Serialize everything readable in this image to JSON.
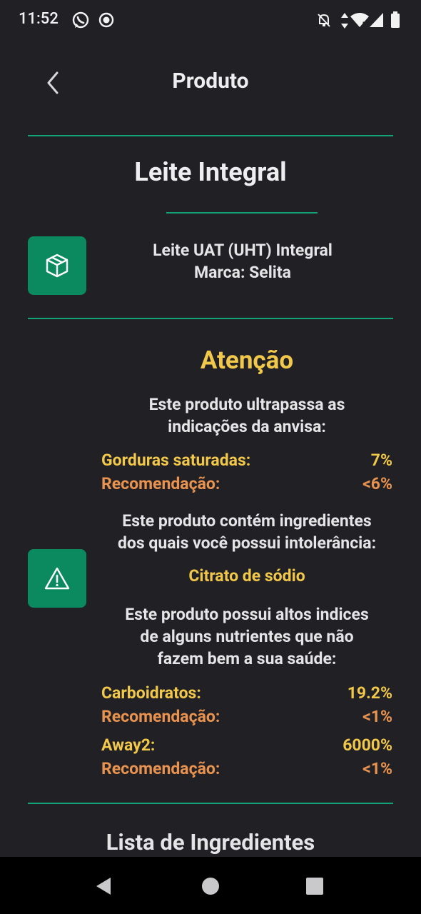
{
  "status_bar": {
    "time": "11:52",
    "icons": [
      "whatsapp-icon",
      "record-icon",
      "notifications-off-icon",
      "data-arrows-icon",
      "wifi-icon",
      "cellular-signal-icon",
      "battery-icon"
    ]
  },
  "header": {
    "title": "Produto",
    "back_icon": "chevron-left-icon"
  },
  "product": {
    "name": "Leite Integral",
    "description": "Leite UAT (UHT) Integral",
    "brand": "Marca: Selita",
    "icon": "box-icon"
  },
  "alert": {
    "icon": "warning-icon",
    "title": "Atenção",
    "anvisa_line1": "Este produto ultrapassa as",
    "anvisa_line2": "indicações da anvisa:",
    "anvisa_items": [
      {
        "label": "Gorduras saturadas:",
        "value": "7%",
        "rec_label": "Recomendação:",
        "rec_value": "<6%"
      }
    ],
    "intolerance_line1": "Este produto contém ingredientes",
    "intolerance_line2": "dos quais você possui intolerância:",
    "intolerance_item": "Citrato de sódio",
    "nutrients_line1": "Este produto possui altos indices",
    "nutrients_line2": "de alguns nutrientes que não",
    "nutrients_line3": "fazem bem a sua saúde:",
    "nutrient_items": [
      {
        "label": "Carboidratos:",
        "value": "19.2%",
        "rec_label": "Recomendação:",
        "rec_value": "<1%"
      },
      {
        "label": "Away2:",
        "value": "6000%",
        "rec_label": "Recomendação:",
        "rec_value": "<1%"
      }
    ]
  },
  "ingredients": {
    "title": "Lista de Ingredientes"
  },
  "colors": {
    "accent": "#13a37a",
    "tile": "#0b8a5f",
    "warning_yellow": "#f2c84b",
    "recommendation_orange": "#e9934f",
    "background": "#212125"
  },
  "nav_bar": {
    "icons": [
      "back-triangle-icon",
      "home-circle-icon",
      "recents-square-icon"
    ]
  }
}
